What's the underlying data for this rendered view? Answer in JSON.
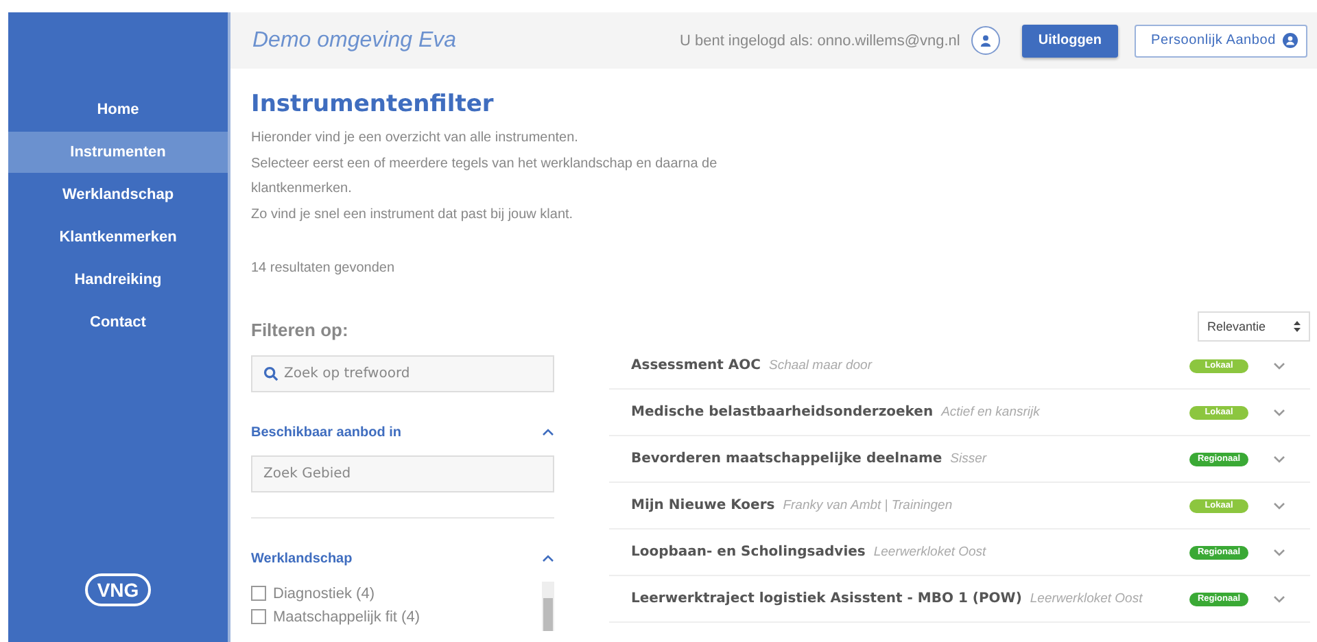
{
  "header": {
    "title": "Demo omgeving Eva",
    "login_text": "U bent ingelogd als: onno.willems@vng.nl",
    "logout_button": "Uitloggen",
    "personal_button": "Persoonlijk Aanbod"
  },
  "sidebar": {
    "items": [
      {
        "label": "Home",
        "selected": false
      },
      {
        "label": "Instrumenten",
        "selected": true
      },
      {
        "label": "Werklandschap",
        "selected": false
      },
      {
        "label": "Klantkenmerken",
        "selected": false
      },
      {
        "label": "Handreiking",
        "selected": false
      },
      {
        "label": "Contact",
        "selected": false
      }
    ],
    "logo": "VNG"
  },
  "page": {
    "title": "Instrumentenfilter",
    "intro": [
      "Hieronder vind je een overzicht van alle instrumenten.",
      "Selecteer eerst een of meerdere tegels van het werklandschap en daarna de klantkenmerken.",
      "Zo vind je snel een instrument dat past bij jouw klant."
    ],
    "result_count": "14 resultaten gevonden"
  },
  "filters": {
    "title": "Filteren op:",
    "search": {
      "placeholder": "Zoek op trefwoord"
    },
    "sections": [
      {
        "title": "Beschikbaar aanbod in",
        "expanded": true,
        "kind": "search",
        "placeholder": "Zoek Gebied"
      },
      {
        "title": "Werklandschap",
        "expanded": true,
        "kind": "checklist",
        "options": [
          {
            "label": "Diagnostiek (4)",
            "checked": false
          },
          {
            "label": "Maatschappelijk fit (4)",
            "checked": false
          }
        ]
      }
    ]
  },
  "sort": {
    "value": "Relevantie"
  },
  "results": [
    {
      "title": "Assessment AOC",
      "provider": "Schaal maar door",
      "badge": "Lokaal",
      "color": "#8cc63f"
    },
    {
      "title": "Medische belastbaarheidsonderzoeken",
      "provider": "Actief en kansrijk",
      "badge": "Lokaal",
      "color": "#8cc63f"
    },
    {
      "title": "Bevorderen maatschappelijke deelname",
      "provider": "Sisser",
      "badge": "Regionaal",
      "color": "#3aa935"
    },
    {
      "title": "Mijn Nieuwe Koers",
      "provider": "Franky van Ambt | Trainingen",
      "badge": "Lokaal",
      "color": "#8cc63f"
    },
    {
      "title": "Loopbaan- en Scholingsadvies",
      "provider": "Leerwerkloket Oost",
      "badge": "Regionaal",
      "color": "#3aa935"
    },
    {
      "title": "Leerwerktraject logistiek Asisstent - MBO 1 (POW)",
      "provider": "Leerwerkloket Oost",
      "badge": "Regionaal",
      "color": "#3aa935"
    }
  ]
}
